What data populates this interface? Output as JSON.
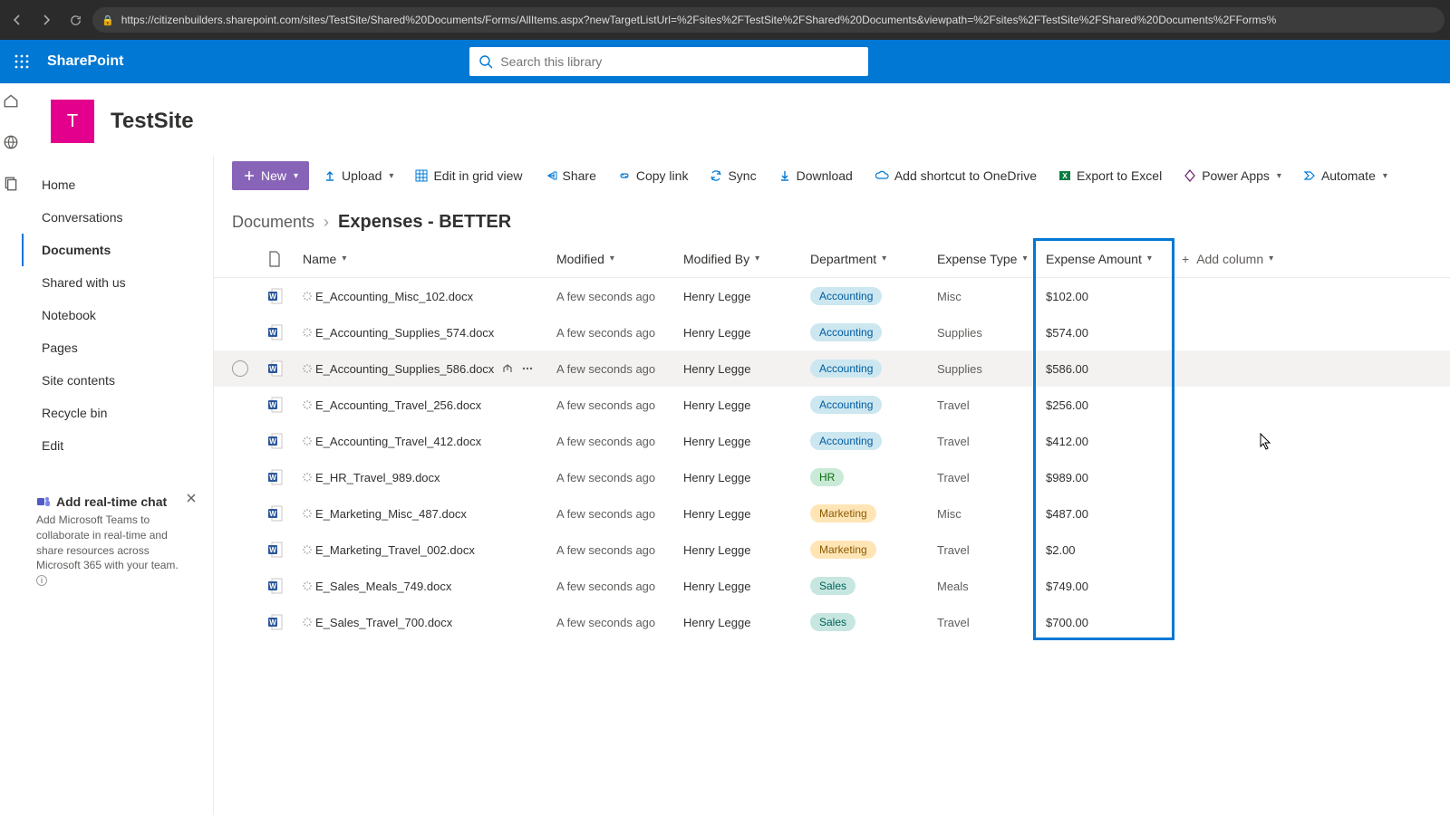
{
  "browser": {
    "url": "https://citizenbuilders.sharepoint.com/sites/TestSite/Shared%20Documents/Forms/AllItems.aspx?newTargetListUrl=%2Fsites%2FTestSite%2FShared%20Documents&viewpath=%2Fsites%2FTestSite%2FShared%20Documents%2FForms%"
  },
  "suite": {
    "product": "SharePoint",
    "search_placeholder": "Search this library"
  },
  "site": {
    "initial": "T",
    "name": "TestSite"
  },
  "nav": {
    "items": [
      "Home",
      "Conversations",
      "Documents",
      "Shared with us",
      "Notebook",
      "Pages",
      "Site contents",
      "Recycle bin",
      "Edit"
    ],
    "selected": "Documents"
  },
  "teach": {
    "title": "Add real-time chat",
    "body": "Add Microsoft Teams to collaborate in real-time and share resources across Microsoft 365 with your team."
  },
  "cmd": {
    "new": "New",
    "upload": "Upload",
    "edit_grid": "Edit in grid view",
    "share": "Share",
    "copy_link": "Copy link",
    "sync": "Sync",
    "download": "Download",
    "shortcut": "Add shortcut to OneDrive",
    "export": "Export to Excel",
    "power_apps": "Power Apps",
    "automate": "Automate"
  },
  "crumb": {
    "root": "Documents",
    "leaf": "Expenses - BETTER"
  },
  "columns": {
    "name": "Name",
    "modified": "Modified",
    "modified_by": "Modified By",
    "department": "Department",
    "expense_type": "Expense Type",
    "expense_amount": "Expense Amount",
    "add_column": "Add column"
  },
  "rows": [
    {
      "name": "E_Accounting_Misc_102.docx",
      "modified": "A few seconds ago",
      "by": "Henry Legge",
      "dept": "Accounting",
      "dept_cls": "acct",
      "etype": "Misc",
      "amount": "$102.00"
    },
    {
      "name": "E_Accounting_Supplies_574.docx",
      "modified": "A few seconds ago",
      "by": "Henry Legge",
      "dept": "Accounting",
      "dept_cls": "acct",
      "etype": "Supplies",
      "amount": "$574.00"
    },
    {
      "name": "E_Accounting_Supplies_586.docx",
      "modified": "A few seconds ago",
      "by": "Henry Legge",
      "dept": "Accounting",
      "dept_cls": "acct",
      "etype": "Supplies",
      "amount": "$586.00",
      "hovered": true
    },
    {
      "name": "E_Accounting_Travel_256.docx",
      "modified": "A few seconds ago",
      "by": "Henry Legge",
      "dept": "Accounting",
      "dept_cls": "acct",
      "etype": "Travel",
      "amount": "$256.00"
    },
    {
      "name": "E_Accounting_Travel_412.docx",
      "modified": "A few seconds ago",
      "by": "Henry Legge",
      "dept": "Accounting",
      "dept_cls": "acct",
      "etype": "Travel",
      "amount": "$412.00"
    },
    {
      "name": "E_HR_Travel_989.docx",
      "modified": "A few seconds ago",
      "by": "Henry Legge",
      "dept": "HR",
      "dept_cls": "hr",
      "etype": "Travel",
      "amount": "$989.00"
    },
    {
      "name": "E_Marketing_Misc_487.docx",
      "modified": "A few seconds ago",
      "by": "Henry Legge",
      "dept": "Marketing",
      "dept_cls": "mkt",
      "etype": "Misc",
      "amount": "$487.00"
    },
    {
      "name": "E_Marketing_Travel_002.docx",
      "modified": "A few seconds ago",
      "by": "Henry Legge",
      "dept": "Marketing",
      "dept_cls": "mkt",
      "etype": "Travel",
      "amount": "$2.00"
    },
    {
      "name": "E_Sales_Meals_749.docx",
      "modified": "A few seconds ago",
      "by": "Henry Legge",
      "dept": "Sales",
      "dept_cls": "sales",
      "etype": "Meals",
      "amount": "$749.00"
    },
    {
      "name": "E_Sales_Travel_700.docx",
      "modified": "A few seconds ago",
      "by": "Henry Legge",
      "dept": "Sales",
      "dept_cls": "sales",
      "etype": "Travel",
      "amount": "$700.00"
    }
  ]
}
